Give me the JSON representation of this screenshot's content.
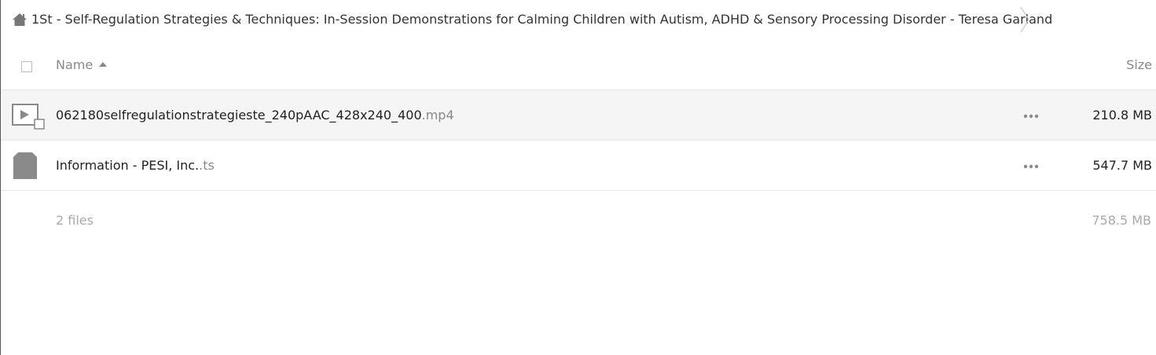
{
  "breadcrumb": {
    "home_icon": "home-icon",
    "folder_title": "1St - Self-Regulation Strategies & Techniques: In-Session Demonstrations for Calming Children with Autism, ADHD & Sensory Processing Disorder - Teresa Garland"
  },
  "columns": {
    "name": "Name",
    "size": "Size",
    "sort_direction": "ascending"
  },
  "files": [
    {
      "name": "062180selfregulationstrategieste_240pAAC_428x240_400",
      "ext": ".mp4",
      "icon": "video-file-icon",
      "size": "210.8 MB",
      "more_icon": "more-options-icon"
    },
    {
      "name": "Information - PESI, Inc.",
      "ext": ".ts",
      "icon": "generic-file-icon",
      "size": "547.7 MB",
      "more_icon": "more-options-icon"
    }
  ],
  "summary": {
    "count": "2 files",
    "total_size": "758.5 MB"
  },
  "colors": {
    "hover_row": "#f5f5f5",
    "icon_gray": "#888888",
    "muted_text": "#aaaaaa"
  }
}
